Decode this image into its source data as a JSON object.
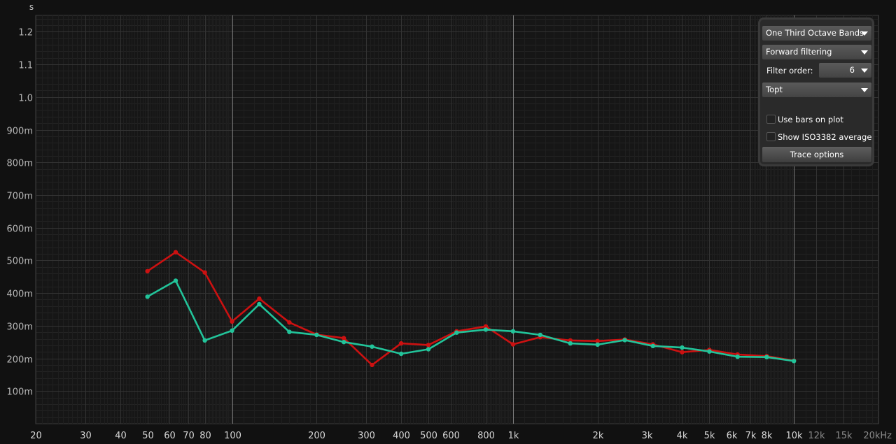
{
  "chart_data": {
    "type": "line",
    "ylabel": "s",
    "xscale": "log",
    "xlim": [
      20,
      20000
    ],
    "ylim": [
      0,
      1.25
    ],
    "grid": true,
    "x_ticks": [
      {
        "value": 20,
        "label": "20"
      },
      {
        "value": 30,
        "label": "30"
      },
      {
        "value": 40,
        "label": "40"
      },
      {
        "value": 50,
        "label": "50"
      },
      {
        "value": 60,
        "label": "60"
      },
      {
        "value": 70,
        "label": "70"
      },
      {
        "value": 80,
        "label": "80"
      },
      {
        "value": 100,
        "label": "100"
      },
      {
        "value": 200,
        "label": "200"
      },
      {
        "value": 300,
        "label": "300"
      },
      {
        "value": 400,
        "label": "400"
      },
      {
        "value": 500,
        "label": "500"
      },
      {
        "value": 600,
        "label": "600"
      },
      {
        "value": 800,
        "label": "800"
      },
      {
        "value": 1000,
        "label": "1k"
      },
      {
        "value": 2000,
        "label": "2k"
      },
      {
        "value": 3000,
        "label": "3k"
      },
      {
        "value": 4000,
        "label": "4k"
      },
      {
        "value": 5000,
        "label": "5k"
      },
      {
        "value": 6000,
        "label": "6k"
      },
      {
        "value": 7000,
        "label": "7k"
      },
      {
        "value": 8000,
        "label": "8k"
      },
      {
        "value": 10000,
        "label": "10k"
      },
      {
        "value": 12000,
        "label": "12k"
      },
      {
        "value": 15000,
        "label": "15k"
      },
      {
        "value": 20000,
        "label": "20kHz"
      }
    ],
    "y_ticks": [
      {
        "value": 0.1,
        "label": "100m"
      },
      {
        "value": 0.2,
        "label": "200m"
      },
      {
        "value": 0.3,
        "label": "300m"
      },
      {
        "value": 0.4,
        "label": "400m"
      },
      {
        "value": 0.5,
        "label": "500m"
      },
      {
        "value": 0.6,
        "label": "600m"
      },
      {
        "value": 0.7,
        "label": "700m"
      },
      {
        "value": 0.8,
        "label": "800m"
      },
      {
        "value": 0.9,
        "label": "900m"
      },
      {
        "value": 1.0,
        "label": "1.0"
      },
      {
        "value": 1.1,
        "label": "1.1"
      },
      {
        "value": 1.2,
        "label": "1.2"
      }
    ],
    "x": [
      50,
      63,
      80,
      100,
      125,
      160,
      200,
      250,
      315,
      400,
      500,
      630,
      800,
      1000,
      1250,
      1600,
      2000,
      2500,
      3150,
      4000,
      5000,
      6300,
      8000,
      10000
    ],
    "series": [
      {
        "color": "#cc1111",
        "values": [
          0.467,
          0.525,
          0.463,
          0.313,
          0.383,
          0.31,
          0.273,
          0.262,
          0.18,
          0.246,
          0.241,
          0.283,
          0.298,
          0.243,
          0.265,
          0.255,
          0.253,
          0.258,
          0.243,
          0.219,
          0.226,
          0.212,
          0.207,
          0.193
        ]
      },
      {
        "color": "#22c49a",
        "values": [
          0.389,
          0.438,
          0.255,
          0.285,
          0.366,
          0.281,
          0.272,
          0.25,
          0.236,
          0.214,
          0.228,
          0.279,
          0.288,
          0.283,
          0.272,
          0.246,
          0.242,
          0.256,
          0.238,
          0.233,
          0.221,
          0.205,
          0.204,
          0.192
        ]
      }
    ]
  },
  "panel": {
    "band_select": "One Third Octave Bands",
    "filter_select": "Forward filtering",
    "filter_order_label": "Filter order:",
    "filter_order_value": "6",
    "metric_select": "Topt",
    "use_bars_label": "Use bars on plot",
    "show_iso_label": "Show ISO3382 average",
    "trace_options_label": "Trace options"
  }
}
